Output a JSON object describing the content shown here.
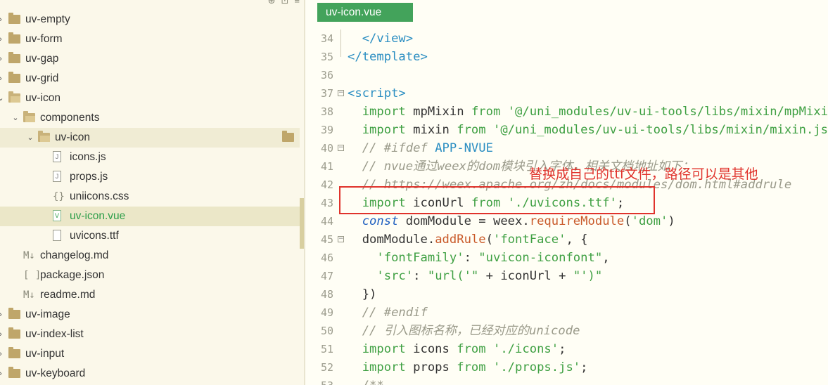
{
  "sidebar": {
    "top_icons": [
      "⊕",
      "⊡",
      "≡"
    ],
    "items": [
      {
        "label": "uv-empty",
        "type": "folder",
        "depth": 0,
        "expanded": false
      },
      {
        "label": "uv-form",
        "type": "folder",
        "depth": 0,
        "expanded": false
      },
      {
        "label": "uv-gap",
        "type": "folder",
        "depth": 0,
        "expanded": false
      },
      {
        "label": "uv-grid",
        "type": "folder",
        "depth": 0,
        "expanded": false
      },
      {
        "label": "uv-icon",
        "type": "folder",
        "depth": 0,
        "expanded": true
      },
      {
        "label": "components",
        "type": "folder",
        "depth": 1,
        "expanded": true
      },
      {
        "label": "uv-icon",
        "type": "folder",
        "depth": 2,
        "expanded": true,
        "selected": true
      },
      {
        "label": "icons.js",
        "type": "js",
        "depth": 3
      },
      {
        "label": "props.js",
        "type": "js",
        "depth": 3
      },
      {
        "label": "uniicons.css",
        "type": "css",
        "depth": 3
      },
      {
        "label": "uv-icon.vue",
        "type": "vue",
        "depth": 3,
        "active": true
      },
      {
        "label": "uvicons.ttf",
        "type": "file",
        "depth": 3
      },
      {
        "label": "changelog.md",
        "type": "md",
        "depth": 1
      },
      {
        "label": "package.json",
        "type": "json",
        "depth": 1
      },
      {
        "label": "readme.md",
        "type": "md",
        "depth": 1
      },
      {
        "label": "uv-image",
        "type": "folder",
        "depth": 0,
        "expanded": false
      },
      {
        "label": "uv-index-list",
        "type": "folder",
        "depth": 0,
        "expanded": false
      },
      {
        "label": "uv-input",
        "type": "folder",
        "depth": 0,
        "expanded": false
      },
      {
        "label": "uv-keyboard",
        "type": "folder",
        "depth": 0,
        "expanded": false
      }
    ]
  },
  "editor": {
    "tab_label": "uv-icon.vue",
    "lines": [
      {
        "n": "34",
        "fold": "",
        "tokens": [
          [
            "tag",
            "  </view>"
          ]
        ]
      },
      {
        "n": "35",
        "fold": "",
        "tokens": [
          [
            "tag",
            "</template>"
          ]
        ]
      },
      {
        "n": "36",
        "fold": "",
        "tokens": []
      },
      {
        "n": "37",
        "fold": "⊟",
        "tokens": [
          [
            "tag",
            "<script>"
          ]
        ]
      },
      {
        "n": "38",
        "fold": "",
        "tokens": [
          [
            "kw",
            "  import "
          ],
          [
            "id",
            "mpMixin "
          ],
          [
            "kw",
            "from "
          ],
          [
            "str",
            "'@/uni_modules/uv-ui-tools/libs/mixin/mpMixin.js'"
          ]
        ]
      },
      {
        "n": "39",
        "fold": "",
        "tokens": [
          [
            "kw",
            "  import "
          ],
          [
            "id",
            "mixin "
          ],
          [
            "kw",
            "from "
          ],
          [
            "str",
            "'@/uni_modules/uv-ui-tools/libs/mixin/mixin.js'"
          ]
        ]
      },
      {
        "n": "40",
        "fold": "⊟",
        "tokens": [
          [
            "cm",
            "  // #ifdef "
          ],
          [
            "upper",
            "APP-NVUE"
          ]
        ]
      },
      {
        "n": "41",
        "fold": "",
        "tokens": [
          [
            "cm",
            "  // nvue通过weex的dom模块引入字体，相关文档地址如下："
          ]
        ]
      },
      {
        "n": "42",
        "fold": "",
        "tokens": [
          [
            "cm",
            "  // https://weex.apache.org/zh/docs/modules/dom.html#addrule"
          ]
        ]
      },
      {
        "n": "43",
        "fold": "",
        "tokens": [
          [
            "kw",
            "  import "
          ],
          [
            "id",
            "iconUrl "
          ],
          [
            "kw",
            "from "
          ],
          [
            "str",
            "'./uvicons.ttf'"
          ],
          [
            "id",
            ";"
          ]
        ]
      },
      {
        "n": "44",
        "fold": "",
        "tokens": [
          [
            "const",
            "  const "
          ],
          [
            "id",
            "domModule = weex."
          ],
          [
            "fn",
            "requireModule"
          ],
          [
            "id",
            "("
          ],
          [
            "str",
            "'dom'"
          ],
          [
            "id",
            ")"
          ]
        ]
      },
      {
        "n": "45",
        "fold": "⊟",
        "tokens": [
          [
            "id",
            "  domModule."
          ],
          [
            "fn",
            "addRule"
          ],
          [
            "id",
            "("
          ],
          [
            "str",
            "'fontFace'"
          ],
          [
            "id",
            ", {"
          ]
        ]
      },
      {
        "n": "46",
        "fold": "",
        "tokens": [
          [
            "str",
            "    'fontFamily'"
          ],
          [
            "id",
            ": "
          ],
          [
            "str",
            "\"uvicon-iconfont\""
          ],
          [
            "id",
            ","
          ]
        ]
      },
      {
        "n": "47",
        "fold": "",
        "tokens": [
          [
            "str",
            "    'src'"
          ],
          [
            "id",
            ": "
          ],
          [
            "str",
            "\"url('\""
          ],
          [
            "id",
            " + iconUrl + "
          ],
          [
            "str",
            "\"')\""
          ]
        ]
      },
      {
        "n": "48",
        "fold": "",
        "tokens": [
          [
            "id",
            "  })"
          ]
        ]
      },
      {
        "n": "49",
        "fold": "",
        "tokens": [
          [
            "cm",
            "  // #endif"
          ]
        ]
      },
      {
        "n": "50",
        "fold": "",
        "tokens": [
          [
            "cm",
            "  // 引入图标名称，已经对应的unicode"
          ]
        ]
      },
      {
        "n": "51",
        "fold": "",
        "tokens": [
          [
            "kw",
            "  import "
          ],
          [
            "id",
            "icons "
          ],
          [
            "kw",
            "from "
          ],
          [
            "str",
            "'./icons'"
          ],
          [
            "id",
            ";"
          ]
        ]
      },
      {
        "n": "52",
        "fold": "",
        "tokens": [
          [
            "kw",
            "  import "
          ],
          [
            "id",
            "props "
          ],
          [
            "kw",
            "from "
          ],
          [
            "str",
            "'./props.js'"
          ],
          [
            "id",
            ";"
          ]
        ]
      },
      {
        "n": "53",
        "fold": "",
        "tokens": [
          [
            "cm",
            "  /**"
          ]
        ]
      }
    ],
    "annotation": "替换成自己的ttf文件，路径可以是其他"
  },
  "colors": {
    "accent": "#43a35b",
    "annotation": "#e0332c",
    "sidebar_bg": "#fbf8ea",
    "editor_bg": "#fffef5"
  }
}
